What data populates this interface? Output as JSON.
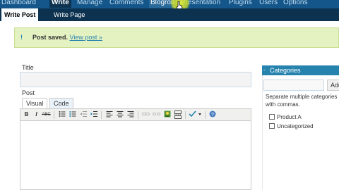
{
  "topnav": {
    "items": [
      "Dashboard",
      "Write",
      "Manage",
      "Comments",
      "Blogroll",
      "Presentation",
      "Plugins",
      "Users",
      "Options"
    ],
    "active": "Write",
    "hovered": "Blogroll"
  },
  "subnav": {
    "items": [
      "Write Post",
      "Write Page"
    ],
    "active": "Write Post"
  },
  "notice": {
    "icon": "info-icon",
    "message": "Post saved.",
    "link": "View post »"
  },
  "form": {
    "title_label": "Title",
    "title_value": "",
    "post_label": "Post",
    "tabs": [
      "Visual",
      "Code"
    ],
    "active_tab": "Visual"
  },
  "toolbar": {
    "buttons": [
      "bold",
      "italic",
      "strikethrough",
      "bulleted-list",
      "numbered-list",
      "outdent",
      "indent",
      "align-left",
      "align-center",
      "align-right",
      "link",
      "unlink",
      "image",
      "more",
      "spellcheck",
      "help"
    ],
    "bold_glyph": "B",
    "italic_glyph": "I",
    "strike_glyph": "ABC"
  },
  "categories": {
    "title": "Categories",
    "toggle": "-",
    "input_value": "",
    "add_label": "Add",
    "help": "Separate multiple categories with commas.",
    "items": [
      {
        "label": "Product A",
        "checked": false
      },
      {
        "label": "Uncategorized",
        "checked": false
      }
    ]
  },
  "colors": {
    "topnav_bg": "#14568a",
    "subnav_bg": "#0d324f",
    "notice_bg": "#e4f2c2",
    "accent": "#2583ad",
    "cursor_highlight": "#e6f03c"
  }
}
